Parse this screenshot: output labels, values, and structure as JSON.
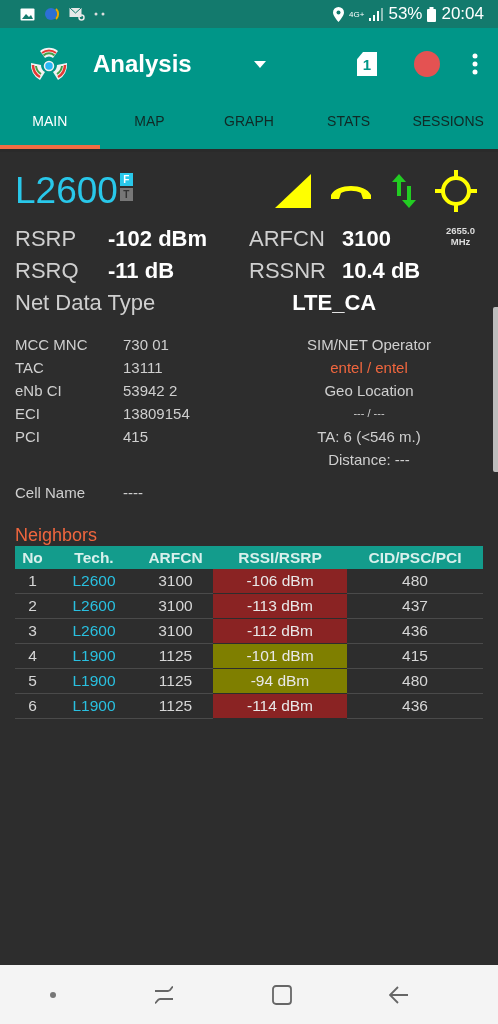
{
  "status_bar": {
    "network": "4G+",
    "battery": "53%",
    "time": "20:04"
  },
  "app_bar": {
    "title": "Analysis",
    "sim_badge": "1",
    "recording": true
  },
  "tabs": [
    {
      "label": "MAIN",
      "selected": true
    },
    {
      "label": "MAP",
      "selected": false
    },
    {
      "label": "GRAPH",
      "selected": false
    },
    {
      "label": "STATS",
      "selected": false
    },
    {
      "label": "SESSIONS",
      "selected": false
    }
  ],
  "serving": {
    "tech": "L2600",
    "flags": [
      {
        "label": "F",
        "active": true
      },
      {
        "label": "T",
        "active": false
      }
    ],
    "metrics": [
      {
        "label": "RSRP",
        "value": "-102 dBm"
      },
      {
        "label": "ARFCN",
        "value": "3100"
      },
      {
        "label": "RSRQ",
        "value": "-11 dB"
      },
      {
        "label": "RSSNR",
        "value": "10.4 dB"
      }
    ],
    "frequency": "2655.0",
    "frequency_unit": "MHz",
    "net_data_type": {
      "label": "Net Data Type",
      "value": "LTE_CA"
    }
  },
  "cell_info": [
    {
      "label": "MCC MNC",
      "value": "730 01"
    },
    {
      "label": "TAC",
      "value": "13111"
    },
    {
      "label": "eNb CI",
      "value": "53942 2"
    },
    {
      "label": "ECI",
      "value": "13809154"
    },
    {
      "label": "PCI",
      "value": "415"
    }
  ],
  "cell_name": {
    "label": "Cell Name",
    "value": "----"
  },
  "location": [
    {
      "kind": "heading",
      "text": "SIM/NET Operator"
    },
    {
      "kind": "operator",
      "text": "entel / entel"
    },
    {
      "kind": "heading",
      "text": "Geo Location"
    },
    {
      "kind": "coords",
      "text": "--- / ---"
    },
    {
      "kind": "heading",
      "text": "TA: 6 (<546 m.)"
    },
    {
      "kind": "heading",
      "text": "Distance: ---"
    }
  ],
  "neighbors": {
    "title": "Neighbors",
    "columns": [
      "No",
      "Tech.",
      "ARFCN",
      "RSSI/RSRP",
      "CID/PSC/PCI"
    ],
    "rows": [
      {
        "no": "1",
        "tech": "L2600",
        "arfcn": "3100",
        "signal": "-106 dBm",
        "color": "#8a2323",
        "cid": "480"
      },
      {
        "no": "2",
        "tech": "L2600",
        "arfcn": "3100",
        "signal": "-113 dBm",
        "color": "#8a2323",
        "cid": "437"
      },
      {
        "no": "3",
        "tech": "L2600",
        "arfcn": "3100",
        "signal": "-112 dBm",
        "color": "#8a2323",
        "cid": "436"
      },
      {
        "no": "4",
        "tech": "L1900",
        "arfcn": "1125",
        "signal": "-101 dBm",
        "color": "#7f7f00",
        "cid": "415"
      },
      {
        "no": "5",
        "tech": "L1900",
        "arfcn": "1125",
        "signal": "-94 dBm",
        "color": "#7f7f00",
        "cid": "480"
      },
      {
        "no": "6",
        "tech": "L1900",
        "arfcn": "1125",
        "signal": "-114 dBm",
        "color": "#8a2323",
        "cid": "436"
      }
    ]
  }
}
